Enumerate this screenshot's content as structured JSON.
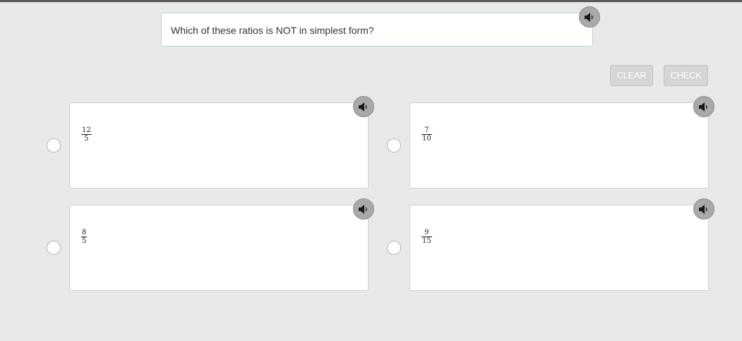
{
  "question": {
    "text": "Which of these ratios is NOT in simplest form?"
  },
  "buttons": {
    "clear_label": "CLEAR",
    "check_label": "CHECK"
  },
  "options": [
    {
      "numerator": "12",
      "denominator": "5"
    },
    {
      "numerator": "7",
      "denominator": "10"
    },
    {
      "numerator": "8",
      "denominator": "5"
    },
    {
      "numerator": "9",
      "denominator": "15"
    }
  ],
  "icons": {
    "speaker": "speaker-icon"
  }
}
